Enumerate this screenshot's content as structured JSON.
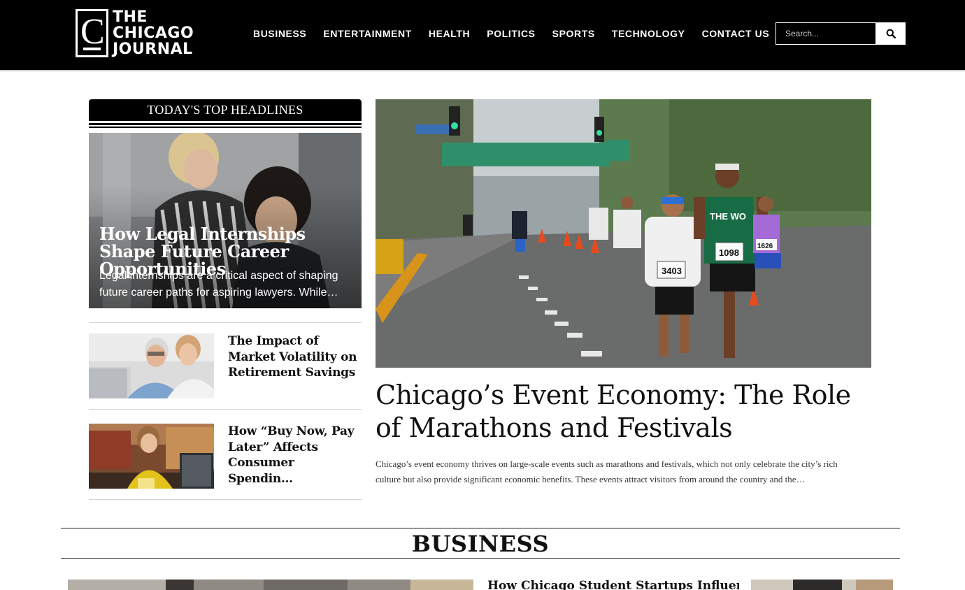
{
  "header": {
    "logo": {
      "line1": "THE",
      "line2": "CHICAGO",
      "line3": "JOURNAL",
      "mark_letter": "C"
    },
    "nav": [
      {
        "label": "BUSINESS"
      },
      {
        "label": "ENTERTAINMENT"
      },
      {
        "label": "HEALTH"
      },
      {
        "label": "POLITICS"
      },
      {
        "label": "SPORTS"
      },
      {
        "label": "TECHNOLOGY"
      },
      {
        "label": "CONTACT US"
      }
    ],
    "search": {
      "placeholder": "Search...",
      "button_icon": "search-icon"
    }
  },
  "top_headlines": {
    "label": "TODAY'S TOP HEADLINES",
    "feature": {
      "title": "How Legal Internships Shape Future Career Opportunities",
      "excerpt": "Legal internships are a critical aspect of shaping future career paths for aspiring lawyers. While…"
    },
    "items": [
      {
        "title": "The Impact of Market Volatility on Retirement Savings"
      },
      {
        "title": "How “Buy Now, Pay Later” Affects Consumer Spendin…"
      }
    ]
  },
  "main_story": {
    "title": "Chicago’s Event Economy: The Role of Marathons and Festivals",
    "excerpt": "Chicago’s event economy thrives on large-scale events such as marathons and festivals, which not only celebrate the city’s rich culture but also provide significant economic benefits. These events attract visitors from around the country and the…",
    "bib_numbers": [
      "1098",
      "3403",
      "1626"
    ],
    "shirt_text": "THE WO"
  },
  "business_section": {
    "title": "BUSINESS",
    "first_headline": "How Chicago Student Startups Influence"
  },
  "colors": {
    "header_bg": "#000000",
    "text": "#111111",
    "divider": "#d4d4d4"
  }
}
